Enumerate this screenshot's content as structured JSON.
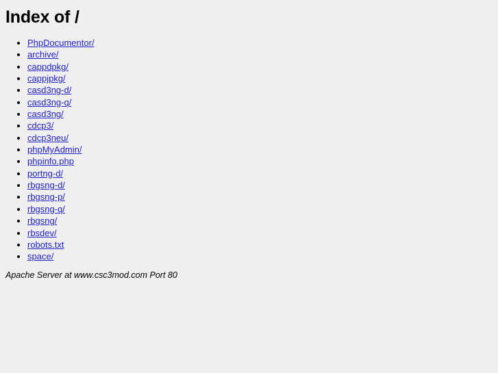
{
  "page": {
    "title": "Index of /",
    "title_path": "/",
    "background_color": "#efefef",
    "link_color": "#2020cc",
    "text_color": "#000000"
  },
  "listing": {
    "items": [
      {
        "label": "PhpDocumentor/",
        "type": "directory"
      },
      {
        "label": "archive/",
        "type": "directory"
      },
      {
        "label": "cappdpkg/",
        "type": "directory"
      },
      {
        "label": "cappjpkg/",
        "type": "directory"
      },
      {
        "label": "casd3ng-d/",
        "type": "directory"
      },
      {
        "label": "casd3ng-q/",
        "type": "directory"
      },
      {
        "label": "casd3ng/",
        "type": "directory"
      },
      {
        "label": "cdcp3/",
        "type": "directory"
      },
      {
        "label": "cdcp3neu/",
        "type": "directory"
      },
      {
        "label": "phpMyAdmin/",
        "type": "directory"
      },
      {
        "label": "phpinfo.php",
        "type": "file"
      },
      {
        "label": "portng-d/",
        "type": "directory"
      },
      {
        "label": "rbgsng-d/",
        "type": "directory"
      },
      {
        "label": "rbgsng-p/",
        "type": "directory"
      },
      {
        "label": "rbgsng-q/",
        "type": "directory"
      },
      {
        "label": "rbgsng/",
        "type": "directory"
      },
      {
        "label": "rbsdev/",
        "type": "directory"
      },
      {
        "label": "robots.txt",
        "type": "file"
      },
      {
        "label": "space/",
        "type": "directory"
      }
    ]
  },
  "footer": {
    "signature": "Apache Server at www.csc3mod.com Port 80",
    "server_software": "Apache",
    "host": "www.csc3mod.com",
    "port": "80"
  }
}
